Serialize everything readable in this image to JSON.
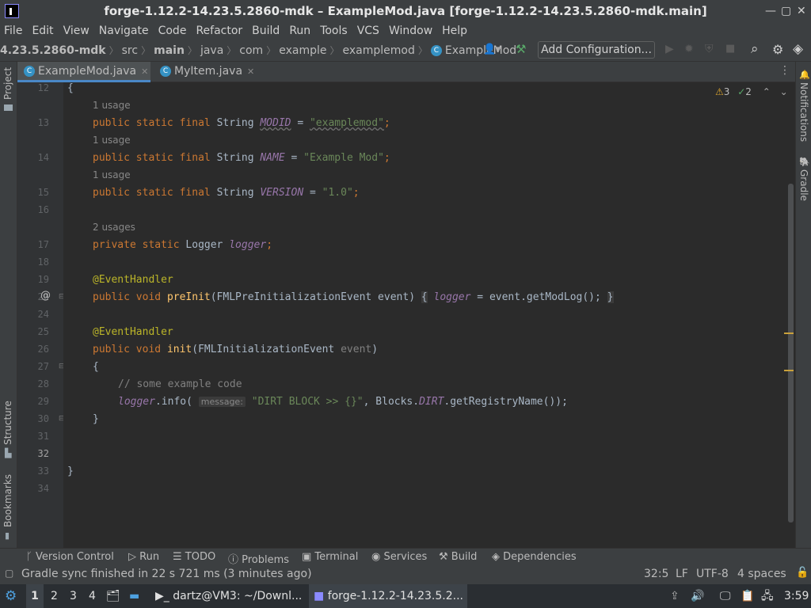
{
  "window": {
    "title": "forge-1.12.2-14.23.5.2860-mdk – ExampleMod.java [forge-1.12.2-14.23.5.2860-mdk.main]",
    "minimize": "—",
    "restore": "▢",
    "close": "✕"
  },
  "menu": [
    "File",
    "Edit",
    "View",
    "Navigate",
    "Code",
    "Refactor",
    "Build",
    "Run",
    "Tools",
    "VCS",
    "Window",
    "Help"
  ],
  "breadcrumbs": [
    "4.23.5.2860-mdk",
    "src",
    "main",
    "java",
    "com",
    "example",
    "examplemod",
    "ExampleMod"
  ],
  "toolbar": {
    "add_config": "Add Configuration..."
  },
  "tabs": [
    {
      "label": "ExampleMod.java",
      "active": true
    },
    {
      "label": "MyItem.java",
      "active": false
    }
  ],
  "left_strip": {
    "project": "Project",
    "structure": "Structure",
    "bookmarks": "Bookmarks"
  },
  "right_strip": {
    "notifications": "Notifications",
    "gradle": "Gradle"
  },
  "inspections": {
    "warnings": "3",
    "weak_warnings": "2"
  },
  "code": {
    "l12": {
      "num": "12",
      "text": "{"
    },
    "u13": "1 usage",
    "l13": {
      "num": "13"
    },
    "u14": "1 usage",
    "l14": {
      "num": "14"
    },
    "u15": "1 usage",
    "l15": {
      "num": "15"
    },
    "l16": {
      "num": "16"
    },
    "u17": "2 usages",
    "l17": {
      "num": "17"
    },
    "l18": {
      "num": "18"
    },
    "l19": {
      "num": "19",
      "text": "@EventHandler"
    },
    "l20": {
      "num": "20"
    },
    "l24": {
      "num": "24"
    },
    "l25": {
      "num": "25",
      "text": "@EventHandler"
    },
    "l26": {
      "num": "26"
    },
    "l27": {
      "num": "27",
      "text": "{"
    },
    "l28": {
      "num": "28",
      "text": "// some example code"
    },
    "l29": {
      "num": "29"
    },
    "l30": {
      "num": "30",
      "text": "}"
    },
    "l31": {
      "num": "31"
    },
    "l32": {
      "num": "32"
    },
    "l33": {
      "num": "33",
      "text": "}"
    },
    "l34": {
      "num": "34"
    }
  },
  "tokens": {
    "public": "public",
    "static": "static",
    "final": "final",
    "private": "private",
    "void": "void",
    "String": "String",
    "Logger": "Logger",
    "MODID": "MODID",
    "NAME": "NAME",
    "VERSION": "VERSION",
    "logger": "logger",
    "modid_val": "\"examplemod\"",
    "name_val": "\"Example Mod\"",
    "version_val": "\"1.0\"",
    "preInit": "preInit",
    "fml_pre": "(FMLPreInitializationEvent event)",
    "brace_open": "{",
    "brace_close": "}",
    "assign": "=",
    "getModLog": "event.getModLog();",
    "init": "init",
    "fml_init": "(FMLInitializationEvent",
    "event": "event",
    "paren_close": ")",
    "info": ".info(",
    "message_hint": "message:",
    "dirt_str": "\"DIRT BLOCK >> {}\"",
    "blocks": ", Blocks.",
    "DIRT": "DIRT",
    "getRegistryName": ".getRegistryName());",
    "semi": ";",
    "at_gutter": "@"
  },
  "tool_windows": [
    "Version Control",
    "Run",
    "TODO",
    "Problems",
    "Terminal",
    "Services",
    "Build",
    "Dependencies"
  ],
  "status": {
    "message": "Gradle sync finished in 22 s 721 ms (3 minutes ago)",
    "position": "32:5",
    "line_sep": "LF",
    "encoding": "UTF-8",
    "indent": "4 spaces"
  },
  "taskbar": {
    "workspaces": [
      "1",
      "2",
      "3",
      "4"
    ],
    "terminal_task": "dartz@VM3: ~/Downl...",
    "ide_task": "forge-1.12.2-14.23.5.2...",
    "clock": "3:59"
  }
}
